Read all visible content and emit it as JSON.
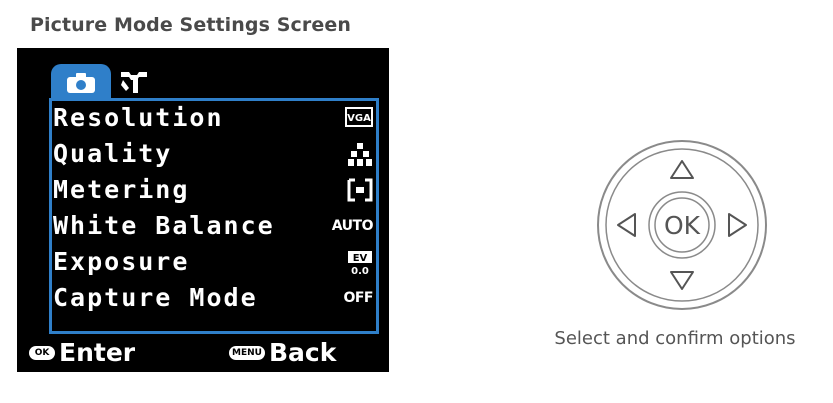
{
  "caption": "Picture Mode Settings Screen",
  "screen": {
    "tabs": [
      {
        "icon": "camera-icon",
        "active": true
      },
      {
        "icon": "settings-tools-icon",
        "active": false
      }
    ],
    "menu": [
      {
        "label": "Resolution",
        "value_icon": "vga-resolution-icon",
        "value": "VGA"
      },
      {
        "label": "Quality",
        "value_icon": "quality-stars-icon",
        "value": ""
      },
      {
        "label": "Metering",
        "value_icon": "metering-center-icon",
        "value": ""
      },
      {
        "label": "White Balance",
        "value_icon": "auto-wb-icon",
        "value": "AUTO"
      },
      {
        "label": "Exposure",
        "value_icon": "ev-icon",
        "value": "EV 0.0"
      },
      {
        "label": "Capture Mode",
        "value_icon": "",
        "value": "OFF"
      }
    ],
    "footer": {
      "enter_key": "OK",
      "enter_label": "Enter",
      "back_key": "MENU",
      "back_label": "Back"
    },
    "colors": {
      "accent": "#2f7fc9",
      "background": "#000000",
      "text": "#ffffff"
    }
  },
  "dpad": {
    "center_label": "OK",
    "caption": "Select and confirm options",
    "arrows": [
      "up-arrow-icon",
      "down-arrow-icon",
      "left-arrow-icon",
      "right-arrow-icon"
    ]
  }
}
